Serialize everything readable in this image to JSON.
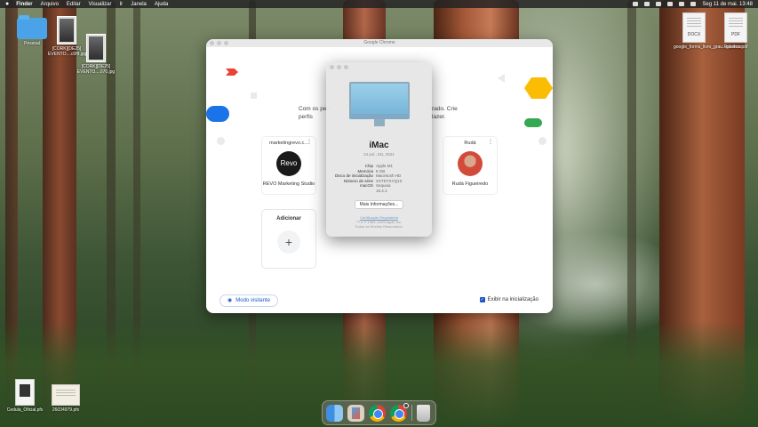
{
  "menubar": {
    "apple": "",
    "items": [
      "Finder",
      "Arquivo",
      "Editar",
      "Visualizar",
      "Ir",
      "Janela",
      "Ajuda"
    ],
    "clock": "Seg 11 de mai. 13:48"
  },
  "desktop": {
    "left_icons": [
      {
        "label": "Pessoal"
      },
      {
        "label": "[CORK][DE25] EVENTO....c0fif.jpg"
      },
      {
        "label": "[CORK][DE25] EVENTO....070.jpg"
      }
    ],
    "right_icons": [
      {
        "label": "google_forms_livro_grau...go.docx",
        "tag": "DOCX"
      },
      {
        "label": "Roteiros.pdf",
        "tag": "PDF"
      }
    ],
    "bottom_icons": [
      {
        "label": "Cedula_Oficial.pfx"
      },
      {
        "label": "26034979.pfx"
      }
    ]
  },
  "chrome_window": {
    "title": "Google Chrome",
    "subtitle_left": "Com os perfi",
    "subtitle_left_2": "perfis",
    "subtitle_right": "nizado. Crie",
    "subtitle_right_2": "lazer.",
    "profiles": [
      {
        "email": "marketingrevo.c...",
        "avatar_text": "Revo",
        "caption": "REVO Marketing Studio"
      },
      {
        "email": "Rudá",
        "avatar_text": "",
        "caption": "Rudá Figueiredo"
      }
    ],
    "add_label": "Adicionar",
    "add_symbol": "+",
    "guest_label": "Modo visitante",
    "show_startup_label": "Exibir na inicialização",
    "show_startup_checked": true
  },
  "about_mac": {
    "model": "iMac",
    "year": "24 pol., M1, 2021",
    "specs": [
      {
        "k": "Chip",
        "v": "Apple M1"
      },
      {
        "k": "Memória",
        "v": "8 GB"
      },
      {
        "k": "Disco de inicialização",
        "v": "Macintosh HD"
      },
      {
        "k": "Número de série",
        "v": "XXTD7XYQ1X"
      },
      {
        "k": "macOS",
        "v": "Sequoia"
      },
      {
        "k": "",
        "v": "15.4.1"
      }
    ],
    "more_info": "Mais Informações...",
    "legal_link": "Certificação Regulatória",
    "legal_line1": "™ e © 1983–2025 Apple Inc.",
    "legal_line2": "Todos os Direitos Reservados."
  },
  "colors": {
    "chrome_blue": "#1a56c4",
    "folder_blue": "#4aa3e8",
    "menubar": "#232323"
  },
  "dock": {
    "apps": [
      "finder-icon",
      "preview-icon",
      "chrome-icon",
      "chrome-icon",
      "trash-icon"
    ]
  }
}
